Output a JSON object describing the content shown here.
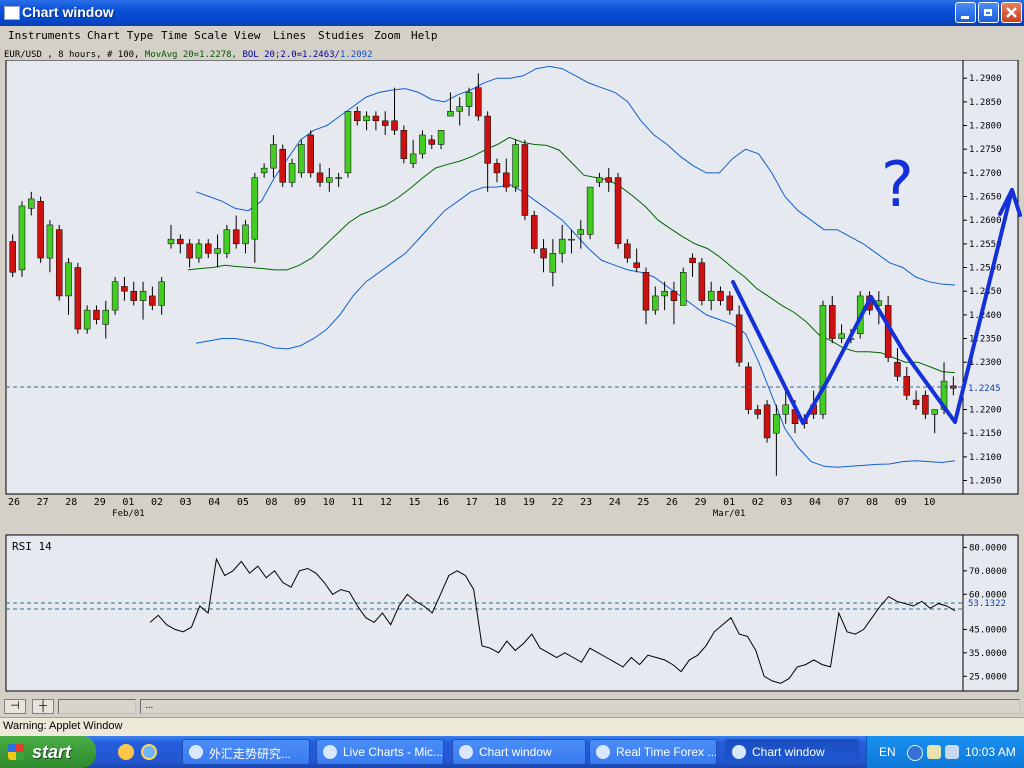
{
  "window": {
    "title": "Chart window"
  },
  "menu": [
    "Instruments",
    "Chart Type",
    "Time Scale",
    "View",
    "Lines",
    "Studies",
    "Zoom",
    "Help"
  ],
  "info": {
    "symbol": "EUR/USD , 8 hours, # 100,",
    "ma": "MovAvg 20=1.2278,",
    "bol": "BOL 20;2.0=1.2463/",
    "bol_lower": "1.2092"
  },
  "price_axis": {
    "ticks": [
      "1.2900",
      "1.2850",
      "1.2800",
      "1.2750",
      "1.2700",
      "1.2650",
      "1.2600",
      "1.2550",
      "1.2500",
      "1.2450",
      "1.2400",
      "1.2350",
      "1.2300",
      "1.2250",
      "1.2200",
      "1.2150",
      "1.2100",
      "1.2050"
    ],
    "current": "1.2245"
  },
  "dates": {
    "labels": [
      "26",
      "27",
      "28",
      "29",
      "01",
      "02",
      "03",
      "04",
      "05",
      "08",
      "09",
      "10",
      "11",
      "12",
      "15",
      "16",
      "17",
      "18",
      "19",
      "22",
      "23",
      "24",
      "25",
      "26",
      "29",
      "01",
      "02",
      "03",
      "04",
      "07",
      "08",
      "09",
      "10"
    ],
    "month_labels": [
      {
        "label": "Feb/01",
        "index": 4
      },
      {
        "label": "Mar/01",
        "index": 25
      }
    ]
  },
  "rsi": {
    "title": "RSI 14",
    "ticks": [
      "80.0000",
      "70.0000",
      "60.0000",
      "45.0000",
      "35.0000",
      "25.0000"
    ],
    "current": "53.1322"
  },
  "annotation": {
    "symbol": "?"
  },
  "toolbar": {
    "pin_icon": "pin-icon",
    "crosshair_icon": "crosshair-icon",
    "field": "..."
  },
  "status": {
    "warning": "Warning: Applet Window"
  },
  "taskbar": {
    "start": "start",
    "tasks": [
      "外汇走势研究...",
      "Live Charts - Mic...",
      "Chart window",
      "Real Time Forex ...",
      "Chart window"
    ],
    "lang": "EN",
    "clock": "10:03 AM"
  },
  "colors": {
    "bull": "#44cc22",
    "bear": "#cc1111",
    "bands": "#1060d0",
    "ma": "#006600",
    "annotation": "#1430d8",
    "chart_bg": "#e6eaf0"
  },
  "chart_data": [
    {
      "type": "candlestick",
      "title": "",
      "ylim": [
        1.203,
        1.293
      ],
      "candles": [
        [
          1.2555,
          1.257,
          1.248,
          1.249
        ],
        [
          1.2495,
          1.264,
          1.248,
          1.263
        ],
        [
          1.2625,
          1.266,
          1.261,
          1.2645
        ],
        [
          1.264,
          1.265,
          1.251,
          1.252
        ],
        [
          1.252,
          1.26,
          1.249,
          1.259
        ],
        [
          1.258,
          1.259,
          1.243,
          1.244
        ],
        [
          1.244,
          1.252,
          1.24,
          1.251
        ],
        [
          1.25,
          1.251,
          1.236,
          1.237
        ],
        [
          1.237,
          1.242,
          1.236,
          1.241
        ],
        [
          1.241,
          1.242,
          1.238,
          1.239
        ],
        [
          1.238,
          1.243,
          1.235,
          1.241
        ],
        [
          1.241,
          1.248,
          1.24,
          1.247
        ],
        [
          1.246,
          1.248,
          1.243,
          1.245
        ],
        [
          1.245,
          1.247,
          1.242,
          1.243
        ],
        [
          1.243,
          1.247,
          1.239,
          1.245
        ],
        [
          1.244,
          1.246,
          1.241,
          1.242
        ],
        [
          1.242,
          1.248,
          1.24,
          1.247
        ],
        [
          1.255,
          1.259,
          1.254,
          1.256
        ],
        [
          1.256,
          1.257,
          1.253,
          1.255
        ],
        [
          1.255,
          1.256,
          1.25,
          1.252
        ],
        [
          1.252,
          1.256,
          1.251,
          1.255
        ],
        [
          1.255,
          1.256,
          1.252,
          1.253
        ],
        [
          1.253,
          1.257,
          1.25,
          1.254
        ],
        [
          1.253,
          1.259,
          1.252,
          1.258
        ],
        [
          1.258,
          1.261,
          1.254,
          1.255
        ],
        [
          1.255,
          1.26,
          1.253,
          1.259
        ],
        [
          1.256,
          1.27,
          1.251,
          1.269
        ],
        [
          1.27,
          1.272,
          1.269,
          1.271
        ],
        [
          1.271,
          1.278,
          1.269,
          1.276
        ],
        [
          1.275,
          1.276,
          1.267,
          1.268
        ],
        [
          1.268,
          1.273,
          1.267,
          1.272
        ],
        [
          1.27,
          1.277,
          1.269,
          1.276
        ],
        [
          1.278,
          1.279,
          1.269,
          1.27
        ],
        [
          1.27,
          1.272,
          1.267,
          1.268
        ],
        [
          1.268,
          1.271,
          1.266,
          1.269
        ],
        [
          1.269,
          1.27,
          1.267,
          1.269
        ],
        [
          1.27,
          1.283,
          1.269,
          1.283
        ],
        [
          1.283,
          1.284,
          1.28,
          1.281
        ],
        [
          1.281,
          1.283,
          1.279,
          1.282
        ],
        [
          1.282,
          1.283,
          1.279,
          1.281
        ],
        [
          1.281,
          1.283,
          1.278,
          1.28
        ],
        [
          1.281,
          1.288,
          1.278,
          1.279
        ],
        [
          1.279,
          1.28,
          1.272,
          1.273
        ],
        [
          1.272,
          1.277,
          1.271,
          1.274
        ],
        [
          1.274,
          1.279,
          1.273,
          1.278
        ],
        [
          1.277,
          1.278,
          1.275,
          1.276
        ],
        [
          1.276,
          1.279,
          1.275,
          1.279
        ],
        [
          1.282,
          1.287,
          1.282,
          1.283
        ],
        [
          1.283,
          1.286,
          1.28,
          1.284
        ],
        [
          1.284,
          1.288,
          1.282,
          1.287
        ],
        [
          1.288,
          1.291,
          1.281,
          1.282
        ],
        [
          1.282,
          1.283,
          1.266,
          1.272
        ],
        [
          1.272,
          1.273,
          1.268,
          1.27
        ],
        [
          1.27,
          1.273,
          1.266,
          1.267
        ],
        [
          1.267,
          1.277,
          1.266,
          1.276
        ],
        [
          1.276,
          1.277,
          1.26,
          1.261
        ],
        [
          1.261,
          1.262,
          1.253,
          1.254
        ],
        [
          1.254,
          1.256,
          1.249,
          1.252
        ],
        [
          1.249,
          1.256,
          1.246,
          1.253
        ],
        [
          1.253,
          1.259,
          1.251,
          1.256
        ],
        [
          1.256,
          1.258,
          1.253,
          1.256
        ],
        [
          1.257,
          1.26,
          1.254,
          1.258
        ],
        [
          1.257,
          1.267,
          1.256,
          1.267
        ],
        [
          1.268,
          1.27,
          1.267,
          1.269
        ],
        [
          1.269,
          1.271,
          1.266,
          1.268
        ],
        [
          1.269,
          1.27,
          1.254,
          1.255
        ],
        [
          1.255,
          1.256,
          1.251,
          1.252
        ],
        [
          1.251,
          1.254,
          1.249,
          1.25
        ],
        [
          1.249,
          1.25,
          1.238,
          1.241
        ],
        [
          1.241,
          1.246,
          1.24,
          1.244
        ],
        [
          1.244,
          1.247,
          1.241,
          1.245
        ],
        [
          1.245,
          1.247,
          1.238,
          1.243
        ],
        [
          1.242,
          1.25,
          1.242,
          1.249
        ],
        [
          1.252,
          1.253,
          1.248,
          1.251
        ],
        [
          1.251,
          1.252,
          1.242,
          1.243
        ],
        [
          1.243,
          1.247,
          1.241,
          1.245
        ],
        [
          1.245,
          1.246,
          1.242,
          1.243
        ],
        [
          1.244,
          1.245,
          1.24,
          1.241
        ],
        [
          1.24,
          1.242,
          1.229,
          1.23
        ],
        [
          1.229,
          1.23,
          1.219,
          1.22
        ],
        [
          1.22,
          1.221,
          1.218,
          1.219
        ],
        [
          1.221,
          1.222,
          1.213,
          1.214
        ],
        [
          1.215,
          1.221,
          1.206,
          1.219
        ],
        [
          1.219,
          1.224,
          1.217,
          1.221
        ],
        [
          1.22,
          1.222,
          1.215,
          1.217
        ],
        [
          1.218,
          1.219,
          1.216,
          1.217
        ],
        [
          1.221,
          1.224,
          1.218,
          1.219
        ],
        [
          1.219,
          1.243,
          1.218,
          1.242
        ],
        [
          1.242,
          1.244,
          1.234,
          1.235
        ],
        [
          1.235,
          1.238,
          1.234,
          1.236
        ],
        [
          1.235,
          1.237,
          1.234,
          1.235
        ],
        [
          1.236,
          1.245,
          1.235,
          1.244
        ],
        [
          1.244,
          1.245,
          1.24,
          1.241
        ],
        [
          1.242,
          1.245,
          1.238,
          1.243
        ],
        [
          1.242,
          1.244,
          1.23,
          1.231
        ],
        [
          1.23,
          1.233,
          1.226,
          1.227
        ],
        [
          1.227,
          1.229,
          1.222,
          1.223
        ],
        [
          1.222,
          1.224,
          1.22,
          1.221
        ],
        [
          1.223,
          1.224,
          1.218,
          1.219
        ],
        [
          1.219,
          1.22,
          1.215,
          1.22
        ],
        [
          1.22,
          1.23,
          1.219,
          1.226
        ],
        [
          1.225,
          1.227,
          1.223,
          1.2245
        ]
      ],
      "ma20": [
        1.2495,
        1.2498,
        1.25,
        1.2505,
        1.2502,
        1.25,
        1.2498,
        1.2495,
        1.2495,
        1.2505,
        1.252,
        1.2545,
        1.257,
        1.2595,
        1.2612,
        1.2622,
        1.2632,
        1.2648,
        1.2668,
        1.269,
        1.271,
        1.2718,
        1.2725,
        1.2735,
        1.2748,
        1.276,
        1.2775,
        1.2765,
        1.276,
        1.2758,
        1.2748,
        1.2722,
        1.2695,
        1.269,
        1.2685,
        1.267,
        1.265,
        1.2628,
        1.26,
        1.2582,
        1.2565,
        1.255,
        1.254,
        1.2522,
        1.25,
        1.248,
        1.2455,
        1.2438,
        1.242,
        1.2405,
        1.2385,
        1.2358,
        1.2345,
        1.233,
        1.2322,
        1.2322,
        1.232,
        1.231,
        1.23,
        1.23,
        1.229,
        1.228,
        1.2278
      ],
      "boll_upper": [
        1.266,
        1.265,
        1.264,
        1.2625,
        1.262,
        1.264,
        1.269,
        1.273,
        1.277,
        1.279,
        1.28,
        1.282,
        1.284,
        1.286,
        1.287,
        1.2875,
        1.2878,
        1.287,
        1.2855,
        1.285,
        1.2865,
        1.2875,
        1.289,
        1.29,
        1.29,
        1.2905,
        1.292,
        1.2925,
        1.292,
        1.2905,
        1.289,
        1.288,
        1.287,
        1.285,
        1.281,
        1.278,
        1.276,
        1.2735,
        1.2715,
        1.27,
        1.27,
        1.273,
        1.275,
        1.274,
        1.27,
        1.265,
        1.262,
        1.26,
        1.258,
        1.258,
        1.2565,
        1.255,
        1.253,
        1.251,
        1.25,
        1.248,
        1.247,
        1.2465,
        1.2463
      ],
      "boll_lower": [
        1.234,
        1.2345,
        1.235,
        1.235,
        1.2345,
        1.234,
        1.233,
        1.2328,
        1.2335,
        1.235,
        1.237,
        1.24,
        1.244,
        1.247,
        1.249,
        1.251,
        1.253,
        1.256,
        1.259,
        1.262,
        1.264,
        1.266,
        1.267,
        1.267,
        1.2675,
        1.266,
        1.264,
        1.262,
        1.26,
        1.257,
        1.254,
        1.2515,
        1.2505,
        1.2495,
        1.249,
        1.248,
        1.246,
        1.244,
        1.242,
        1.24,
        1.239,
        1.238,
        1.236,
        1.23,
        1.223,
        1.216,
        1.212,
        1.209,
        1.208,
        1.2078,
        1.208,
        1.2082,
        1.2084,
        1.2085,
        1.209,
        1.2092,
        1.209,
        1.2088,
        1.2092
      ]
    },
    {
      "type": "line",
      "title": "RSI 14",
      "ylim": [
        20,
        84
      ],
      "values": [
        48,
        51,
        47,
        45,
        44,
        46,
        55,
        52,
        75,
        68,
        70,
        74,
        69,
        72,
        67,
        70,
        65,
        63,
        70,
        71,
        69,
        65,
        60,
        62,
        61,
        55,
        50,
        48,
        52,
        47,
        55,
        60,
        57,
        55,
        52,
        60,
        68,
        70,
        68,
        62,
        38,
        37,
        35,
        40,
        36,
        39,
        43,
        37,
        35,
        33,
        35,
        33,
        31,
        37,
        35,
        33,
        31,
        29,
        33,
        30,
        34,
        33,
        32,
        30,
        27,
        32,
        34,
        38,
        44,
        47,
        50,
        43,
        42,
        36,
        25,
        23,
        22,
        24,
        29,
        30,
        32,
        30,
        29,
        52,
        44,
        43,
        45,
        50,
        55,
        59,
        57,
        56,
        55,
        57,
        54,
        56,
        55,
        53
      ]
    }
  ]
}
